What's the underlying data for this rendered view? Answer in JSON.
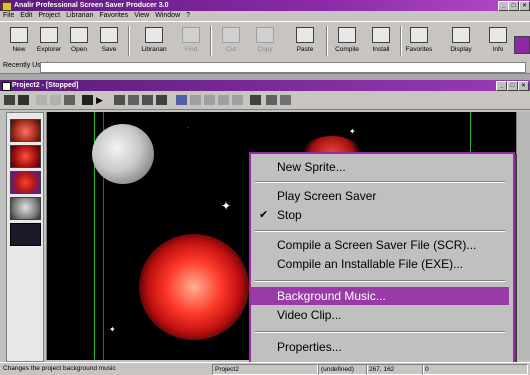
{
  "app": {
    "title": "Analir Professional Screen Saver Producer 3.0",
    "controls": [
      "_",
      "□",
      "×"
    ]
  },
  "menubar": [
    "File",
    "Edit",
    "Project",
    "Librarian",
    "Favorites",
    "View",
    "Window",
    "?"
  ],
  "toolbar": {
    "items": [
      {
        "label": "New",
        "icon": "new-document-icon",
        "enabled": true
      },
      {
        "label": "Explorer",
        "icon": "explorer-icon",
        "enabled": true
      },
      {
        "label": "Open",
        "icon": "open-folder-icon",
        "enabled": true
      },
      {
        "label": "Save",
        "icon": "save-icon",
        "enabled": true
      },
      {
        "label": "Librarian",
        "icon": "librarian-icon",
        "enabled": true
      },
      {
        "label": "Find",
        "icon": "find-icon",
        "enabled": false
      },
      {
        "label": "Cut",
        "icon": "cut-icon",
        "enabled": false
      },
      {
        "label": "Copy",
        "icon": "copy-icon",
        "enabled": false
      },
      {
        "label": "Paste",
        "icon": "paste-icon",
        "enabled": true
      },
      {
        "label": "Compile",
        "icon": "compile-icon",
        "enabled": true
      },
      {
        "label": "Install",
        "icon": "install-icon",
        "enabled": true
      },
      {
        "label": "Favorites",
        "icon": "favorites-icon",
        "enabled": true
      },
      {
        "label": "Display",
        "icon": "display-icon",
        "enabled": true
      },
      {
        "label": "Info",
        "icon": "info-icon",
        "enabled": true
      }
    ]
  },
  "recent": {
    "label": "Recently Used",
    "value": ""
  },
  "project_window": {
    "title": "Project2 - [Stopped]",
    "controls": [
      "_",
      "□",
      "×"
    ]
  },
  "context_menu": {
    "items": [
      {
        "label": "New Sprite...",
        "checked": false,
        "highlighted": false
      },
      {
        "separator": true
      },
      {
        "label": "Play Screen Saver",
        "checked": false,
        "highlighted": false
      },
      {
        "label": "Stop",
        "checked": true,
        "highlighted": false
      },
      {
        "separator": true
      },
      {
        "label": "Compile a Screen Saver File (SCR)...",
        "checked": false,
        "highlighted": false
      },
      {
        "label": "Compile an Installable File (EXE)...",
        "checked": false,
        "highlighted": false
      },
      {
        "separator": true
      },
      {
        "label": "Background Music...",
        "checked": false,
        "highlighted": true
      },
      {
        "label": "Video Clip...",
        "checked": false,
        "highlighted": false
      },
      {
        "separator": true
      },
      {
        "label": "Properties...",
        "checked": false,
        "highlighted": false
      }
    ]
  },
  "status": {
    "message": "Changes the project background music",
    "project": "Project2",
    "state": "(undefined)",
    "coords": "267, 162",
    "extra": "0"
  },
  "colors": {
    "titlebar": "#7a2a98",
    "menu_highlight": "#9a3aa8",
    "canvas": "#000000"
  }
}
